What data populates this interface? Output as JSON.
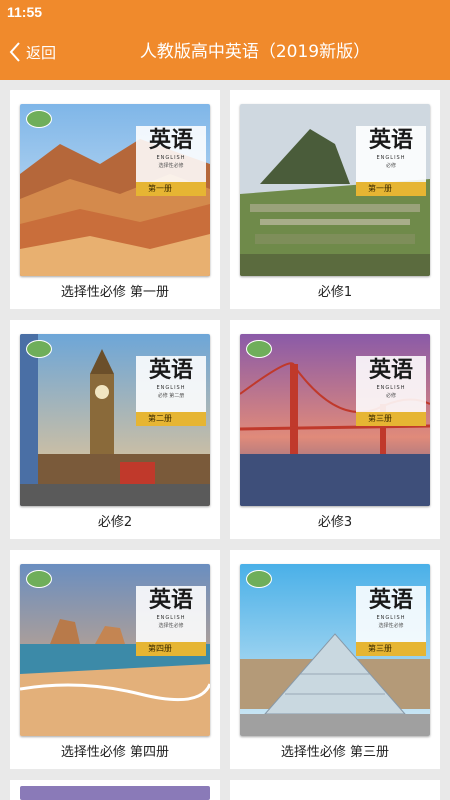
{
  "status_bar": {
    "time": "11:55"
  },
  "app_bar": {
    "back_label": "返回",
    "title": "人教版高中英语（2019新版）"
  },
  "books": [
    {
      "label": "选择性必修 第一册",
      "cover_title": "英语",
      "cover_en": "ENGLISH",
      "cover_sub": "选择性必修",
      "cover_vol": "第一册",
      "scene": "mountains"
    },
    {
      "label": "必修1",
      "cover_title": "英语",
      "cover_en": "ENGLISH",
      "cover_sub": "必修",
      "cover_vol": "第一册",
      "scene": "machu-picchu"
    },
    {
      "label": "必修2",
      "cover_title": "英语",
      "cover_en": "ENGLISH",
      "cover_sub": "必修 第二册",
      "cover_vol": "第二册",
      "scene": "big-ben"
    },
    {
      "label": "必修3",
      "cover_title": "英语",
      "cover_en": "ENGLISH",
      "cover_sub": "必修",
      "cover_vol": "第三册",
      "scene": "golden-gate"
    },
    {
      "label": "选择性必修 第四册",
      "cover_title": "英语",
      "cover_en": "ENGLISH",
      "cover_sub": "选择性必修",
      "cover_vol": "第四册",
      "scene": "coast"
    },
    {
      "label": "选择性必修 第三册",
      "cover_title": "英语",
      "cover_en": "ENGLISH",
      "cover_sub": "选择性必修",
      "cover_vol": "第三册",
      "scene": "louvre"
    }
  ],
  "colors": {
    "accent": "#f08a2c",
    "background": "#e9e9e9",
    "card": "#ffffff"
  }
}
